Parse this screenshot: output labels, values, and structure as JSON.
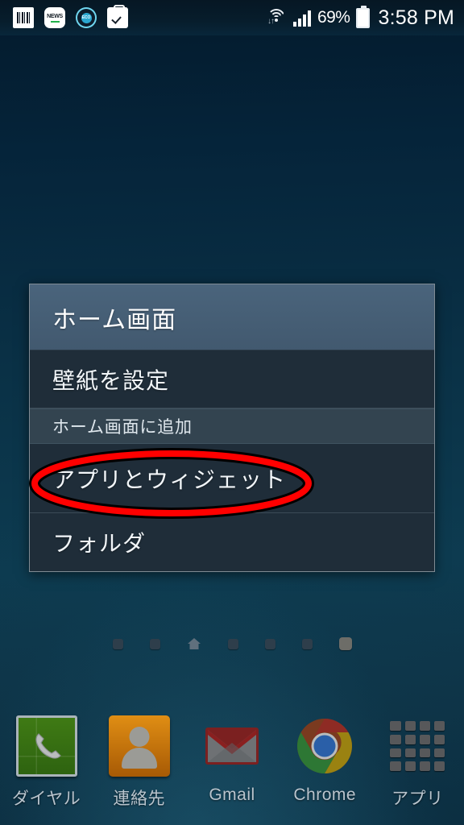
{
  "status_bar": {
    "notification_icons": [
      {
        "name": "barcode-icon",
        "label": "barcode"
      },
      {
        "name": "news-icon",
        "label": "NEWS"
      },
      {
        "name": "eco-icon",
        "label": "ECO"
      },
      {
        "name": "briefcase-check-icon",
        "label": "task"
      }
    ],
    "wifi_icon": "wifi-icon",
    "signal_icon": "cellular-signal-icon",
    "battery_percent": "69%",
    "battery_icon": "battery-icon",
    "clock": "3:58 PM"
  },
  "context_menu": {
    "title": "ホーム画面",
    "items": [
      {
        "label": "壁紙を設定",
        "type": "item"
      },
      {
        "label": "ホーム画面に追加",
        "type": "section"
      },
      {
        "label": "アプリとウィジェット",
        "type": "item",
        "highlighted": true
      },
      {
        "label": "フォルダ",
        "type": "item"
      }
    ]
  },
  "annotation": {
    "shape": "ellipse",
    "color": "#ff0000",
    "outline_color": "#000000",
    "targets": "アプリとウィジェット"
  },
  "page_indicator": {
    "total_pages": 7,
    "home_page_index": 3,
    "active_page_index": 7
  },
  "dock": {
    "items": [
      {
        "label": "ダイヤル",
        "icon": "phone-icon"
      },
      {
        "label": "連絡先",
        "icon": "contacts-icon"
      },
      {
        "label": "Gmail",
        "icon": "gmail-icon"
      },
      {
        "label": "Chrome",
        "icon": "chrome-icon"
      },
      {
        "label": "アプリ",
        "icon": "apps-grid-icon"
      }
    ]
  },
  "colors": {
    "wallpaper_top": "#062034",
    "wallpaper_bottom": "#0d3b50",
    "menu_header": "#46607a",
    "menu_item": "#1f2d39",
    "menu_section": "#334450",
    "annotation_red": "#ff0000"
  }
}
